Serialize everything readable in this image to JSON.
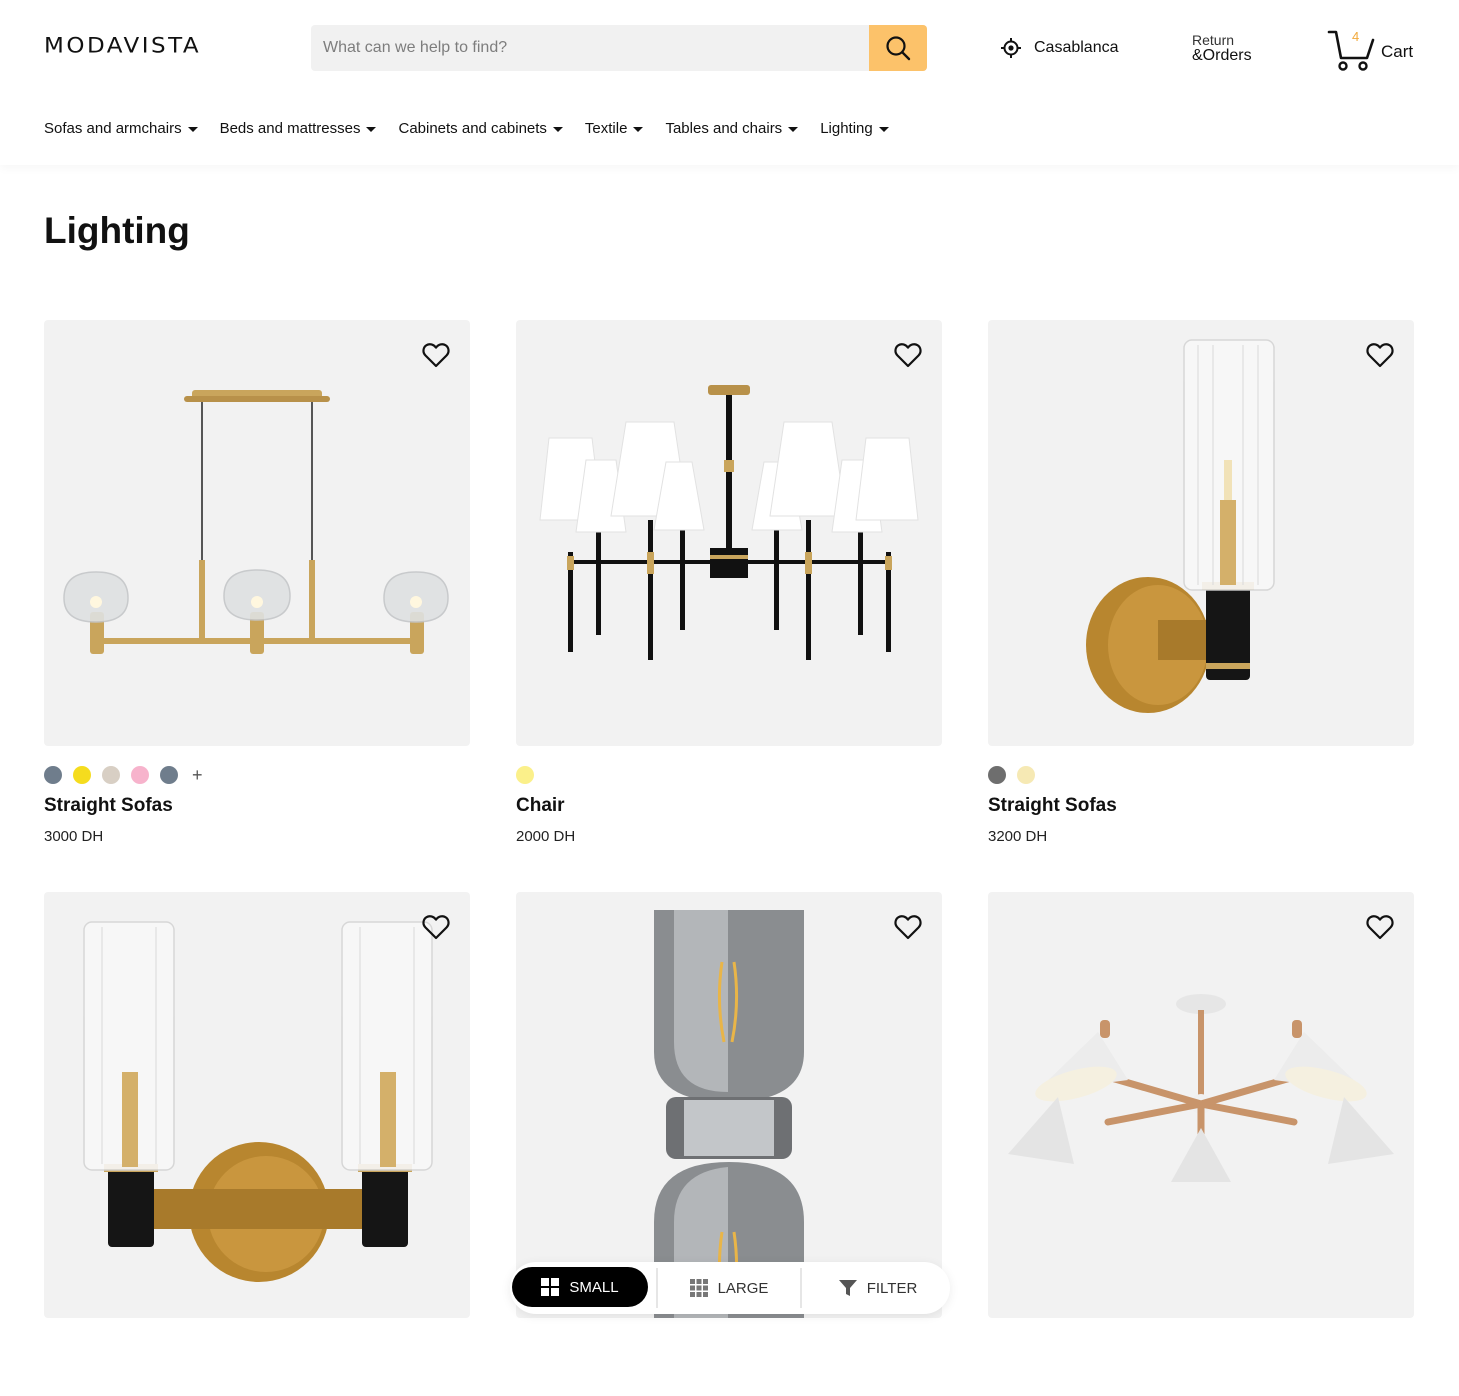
{
  "header": {
    "logo": "MODAVISTA",
    "search_placeholder": "What can we help to find?",
    "location": "Casablanca",
    "orders_line1": "Return",
    "orders_line2": "&Orders",
    "cart_count": "4",
    "cart_label": "Cart",
    "accent_color": "#fcc26a"
  },
  "nav": [
    {
      "label": "Sofas and armchairs"
    },
    {
      "label": "Beds and mattresses"
    },
    {
      "label": "Cabinets and cabinets"
    },
    {
      "label": "Textile"
    },
    {
      "label": "Tables and chairs"
    },
    {
      "label": "Lighting"
    }
  ],
  "page_title": "Lighting",
  "products": [
    {
      "name": "Straight Sofas",
      "price": "3000 DH",
      "swatches": [
        "#6f7d8c",
        "#f5dc1e",
        "#d8cfc4",
        "#f7b3cc",
        "#6f7d8c"
      ],
      "more": "+",
      "image_icon": "linear-pendant-icon"
    },
    {
      "name": "Chair",
      "price": "2000 DH",
      "swatches": [
        "#fbf08a"
      ],
      "more": "",
      "image_icon": "chandelier-icon"
    },
    {
      "name": "Straight Sofas",
      "price": "3200 DH",
      "swatches": [
        "#6e6e6e",
        "#f6e9b4"
      ],
      "more": "",
      "image_icon": "wall-sconce-icon"
    },
    {
      "name": "",
      "price": "",
      "swatches": [],
      "more": "",
      "image_icon": "double-sconce-icon"
    },
    {
      "name": "",
      "price": "",
      "swatches": [],
      "more": "",
      "image_icon": "chrome-pendant-icon"
    },
    {
      "name": "",
      "price": "",
      "swatches": [],
      "more": "",
      "image_icon": "cone-chandelier-icon"
    }
  ],
  "toolbar": {
    "small_label": "SMALL",
    "large_label": "LARGE",
    "filter_label": "FILTER",
    "active": "small"
  }
}
